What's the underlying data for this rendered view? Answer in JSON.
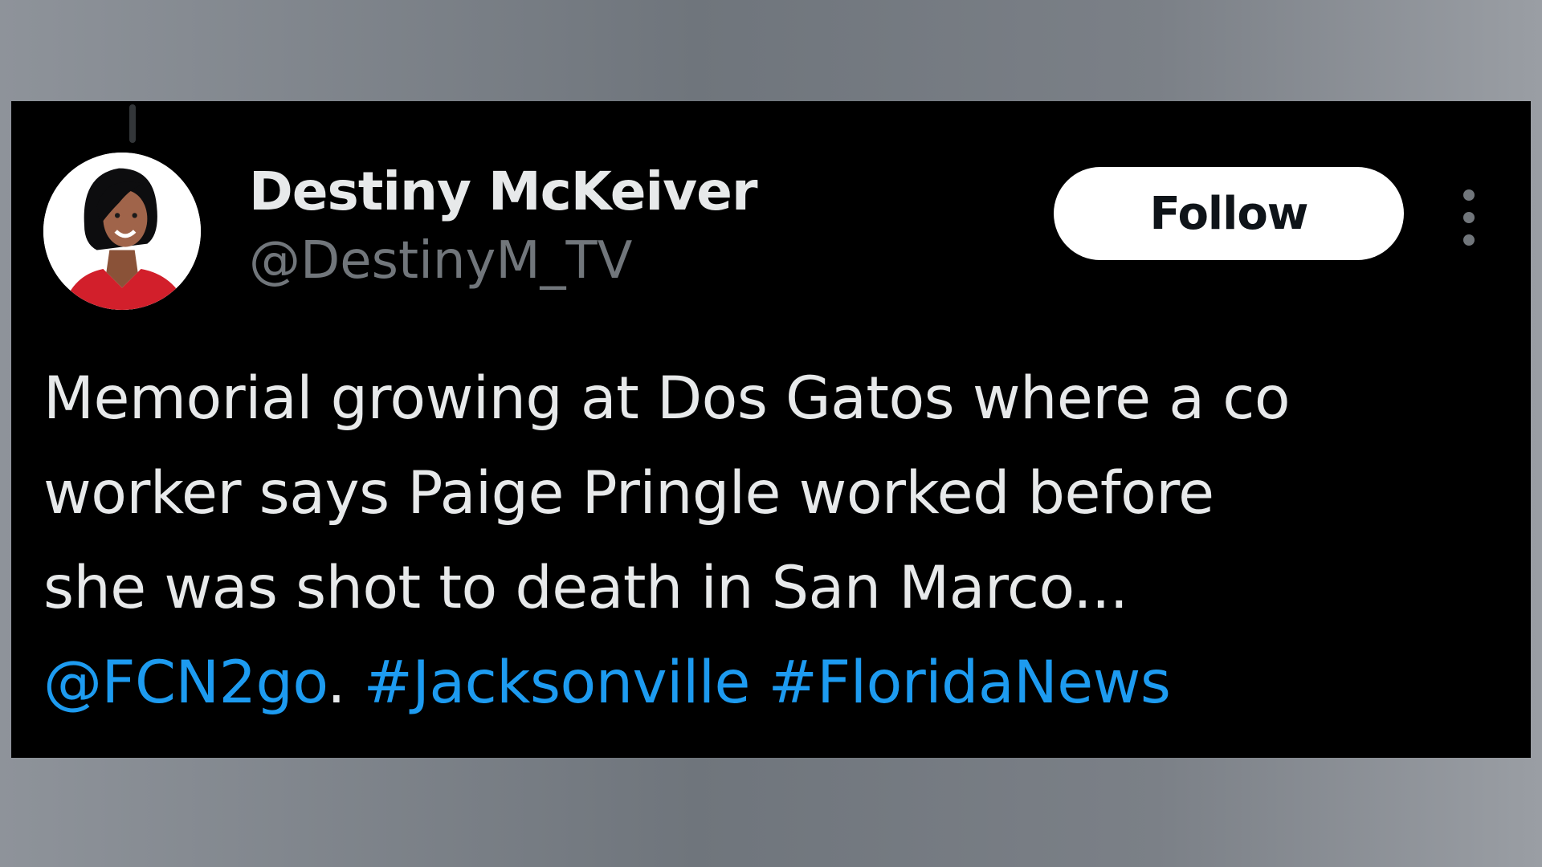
{
  "tweet": {
    "author": {
      "display_name": "Destiny McKeiver",
      "handle": "@DestinyM_TV",
      "avatar_icon": "profile-photo"
    },
    "follow_label": "Follow",
    "more_icon": "more-options-vertical-icon",
    "text_lines": [
      "Memorial growing at Dos Gatos where a co",
      "worker says Paige Pringle worked before",
      "she was shot to death in San Marco..."
    ],
    "mention": "@FCN2go",
    "separator": ". ",
    "hashtags": [
      "#Jacksonville",
      "#FloridaNews"
    ]
  },
  "colors": {
    "card_background": "#000000",
    "primary_text": "#e7e9ea",
    "secondary_text": "#71767b",
    "link": "#1d9bf0",
    "follow_button_bg": "#ffffff"
  }
}
